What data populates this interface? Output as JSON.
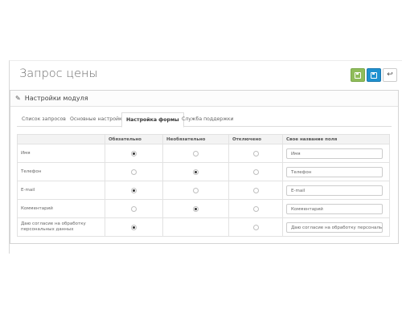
{
  "page": {
    "title": "Запрос цены"
  },
  "toolbar": {
    "save_icon": "floppy-disk-icon",
    "apply_icon": "floppy-disk-icon",
    "back_icon": "reply-arrow-icon",
    "save_color": "#8fbc5a",
    "apply_color": "#1e91cf"
  },
  "panel": {
    "heading": "Настройки модуля",
    "heading_icon": "pencil-icon"
  },
  "tabs": [
    {
      "label": "Список запросов",
      "active": false
    },
    {
      "label": "Основные настройки",
      "active": false
    },
    {
      "label": "Настройка формы",
      "active": true
    },
    {
      "label": "Служба поддержки",
      "active": false
    }
  ],
  "table": {
    "headers": [
      "",
      "Обязательно",
      "Необязательно",
      "Отключено",
      "Свое название поля"
    ],
    "rows": [
      {
        "label": "Имя",
        "selected": "required",
        "field": "Имя"
      },
      {
        "label": "Телефон",
        "selected": "optional",
        "field": "Телефон"
      },
      {
        "label": "E-mail",
        "selected": "required",
        "field": "E-mail"
      },
      {
        "label": "Комментарий",
        "selected": "optional",
        "field": "Комментарий"
      },
      {
        "label_line1": "Даю согласие на обработку",
        "label_line2": "персональных данных",
        "selected": "required",
        "field": "Даю согласие на обработку персональных данных"
      }
    ]
  }
}
